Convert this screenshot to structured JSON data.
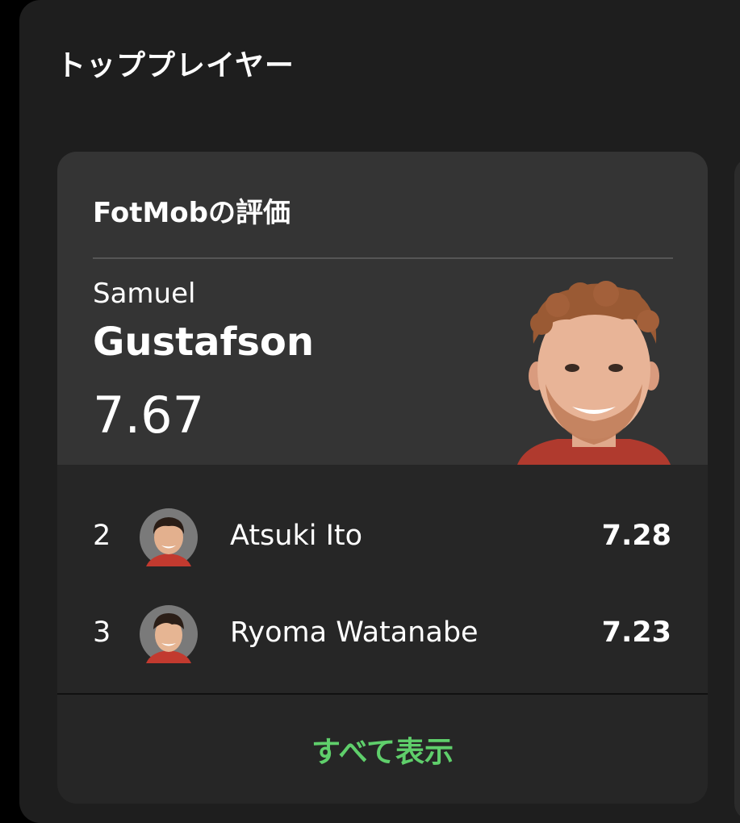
{
  "section": {
    "title": "トッププレイヤー"
  },
  "card": {
    "title": "FotMobの評価",
    "top_player": {
      "first_name": "Samuel",
      "last_name": "Gustafson",
      "rating": "7.67"
    },
    "rankings": [
      {
        "rank": "2",
        "name": "Atsuki Ito",
        "rating": "7.28"
      },
      {
        "rank": "3",
        "name": "Ryoma Watanabe",
        "rating": "7.23"
      }
    ],
    "show_all_label": "すべて表示"
  },
  "colors": {
    "background": "#000000",
    "panel": "#1e1e1e",
    "card_top": "#343434",
    "card_bottom": "#262626",
    "accent_green": "#5fcf6b",
    "text": "#ffffff"
  },
  "icons": {
    "top_player_photo": "player-photo",
    "rank_avatar": "player-avatar"
  }
}
